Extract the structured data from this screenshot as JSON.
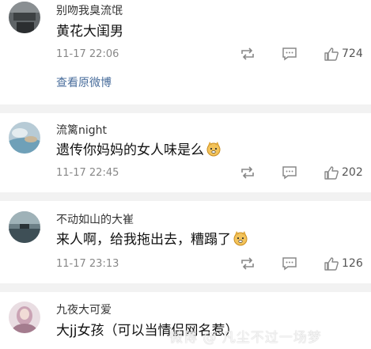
{
  "comments": [
    {
      "username": "别吻我臭流氓",
      "text": "黄花大闺男",
      "time": "11-17 22:06",
      "likes": "724",
      "show_original": "查看原微博",
      "emoji": ""
    },
    {
      "username": "流篱night",
      "text": "遗传你妈妈的女人味是么",
      "time": "11-17 22:45",
      "likes": "202",
      "emoji": "doge-emoji"
    },
    {
      "username": "不动如山的大崔",
      "text": "来人啊，给我拖出去，糟蹋了",
      "time": "11-17 23:13",
      "likes": "126",
      "emoji": "doge-emoji"
    },
    {
      "username": "九夜大可爱",
      "text": "大jj女孩（可以当情侣网名惹）",
      "time": "",
      "likes": "",
      "emoji": ""
    }
  ],
  "watermark": "微博 @ 凡尘不过一场梦",
  "icons": {
    "repost": "repost-icon",
    "comment": "comment-icon",
    "like": "thumbs-up-icon"
  },
  "colors": {
    "link": "#4a6e9c",
    "separator": "#f2f2f2",
    "text": "#111111",
    "meta": "#888888"
  }
}
